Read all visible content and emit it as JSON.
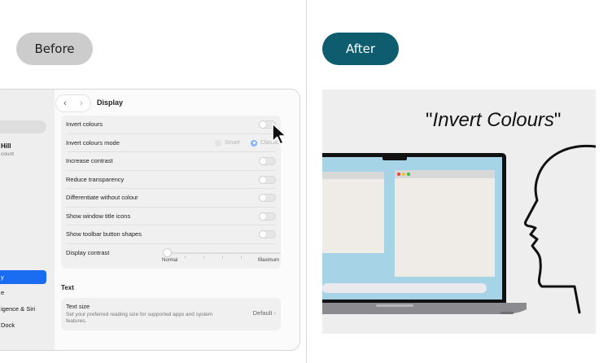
{
  "labels": {
    "before": "Before",
    "after": "After"
  },
  "sidebar": {
    "user_name": "Hill",
    "user_sub": "count",
    "items": [
      {
        "label": "y",
        "selected": true
      },
      {
        "label": "e",
        "selected": false
      },
      {
        "label": "igence & Siri",
        "selected": false
      },
      {
        "label": "Dock",
        "selected": false
      }
    ]
  },
  "header": {
    "back_icon": "chevron-left",
    "forward_icon": "chevron-right",
    "title": "Display"
  },
  "settings": {
    "invert_colours": "Invert colours",
    "invert_mode": {
      "label": "Invert colours mode",
      "options": [
        "Smart",
        "Classic"
      ],
      "selected": "Classic"
    },
    "increase_contrast": "Increase contrast",
    "reduce_transparency": "Reduce transparency",
    "differentiate": "Differentiate without colour",
    "window_title_icons": "Show window title icons",
    "toolbar_shapes": "Show toolbar button shapes",
    "display_contrast": {
      "label": "Display contrast",
      "min_label": "Normal",
      "max_label": "Maximum",
      "level": 0
    }
  },
  "text_section": {
    "heading": "Text",
    "text_size": {
      "label": "Text size",
      "description": "Set your preferred reading size for supported apps and system features.",
      "value": "Default"
    }
  },
  "illustration": {
    "quote_open": "\"",
    "quote_text": "Invert Colours",
    "quote_close": "\""
  },
  "colors": {
    "after_accent": "#0d5d6e",
    "selection_blue": "#1a6cf0",
    "screen_blue": "#a6d3e6"
  }
}
